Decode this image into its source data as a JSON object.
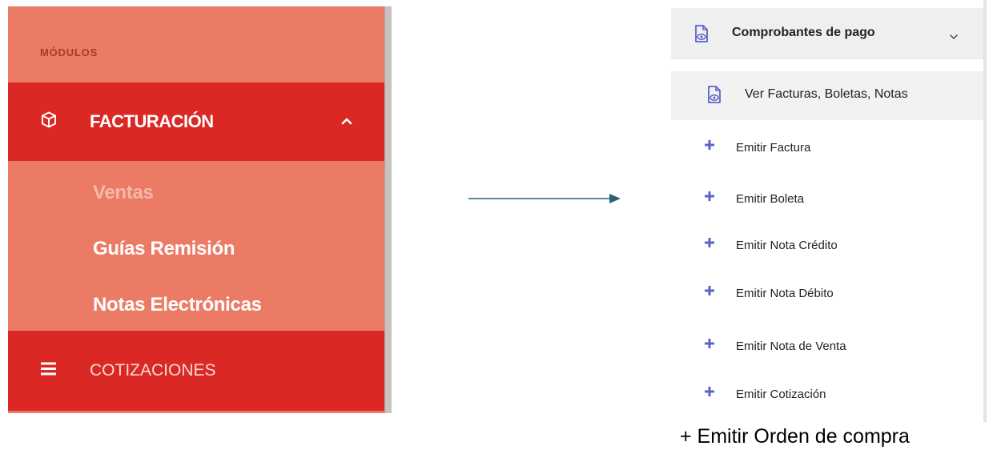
{
  "left_menu": {
    "section_label": "MÓDULOS",
    "facturacion": {
      "label": "FACTURACIÓN",
      "icon": "cube-icon",
      "expanded": true
    },
    "sub_items": [
      {
        "label": "Ventas",
        "active": true
      },
      {
        "label": "Guías Remisión",
        "active": false
      },
      {
        "label": "Notas Electrónicas",
        "active": false
      }
    ],
    "cotizaciones": {
      "label": "COTIZACIONES",
      "icon": "menu-lines-icon"
    }
  },
  "right_menu": {
    "header": {
      "label": "Comprobantes de pago",
      "icon": "document-eye-icon",
      "expanded": true
    },
    "view_item": {
      "label": "Ver Facturas, Boletas, Notas",
      "icon": "document-eye-icon"
    },
    "emit_items": [
      {
        "label": "Emitir Factura",
        "icon": "plus-icon"
      },
      {
        "label": "Emitir Boleta",
        "icon": "plus-icon"
      },
      {
        "label": "Emitir Nota Crédito",
        "icon": "plus-icon"
      },
      {
        "label": "Emitir Nota Débito",
        "icon": "plus-icon"
      },
      {
        "label": "Emitir Nota de Venta",
        "icon": "plus-icon"
      },
      {
        "label": "Emitir Cotización",
        "icon": "plus-icon"
      }
    ]
  },
  "annotation": {
    "text": "+ Emitir Orden de compra"
  },
  "colors": {
    "sidebar_bg": "#ec7b66",
    "sidebar_header_bg": "#db2825",
    "plus_icon": "#5b63c9",
    "arrow": "#2c5f78"
  }
}
